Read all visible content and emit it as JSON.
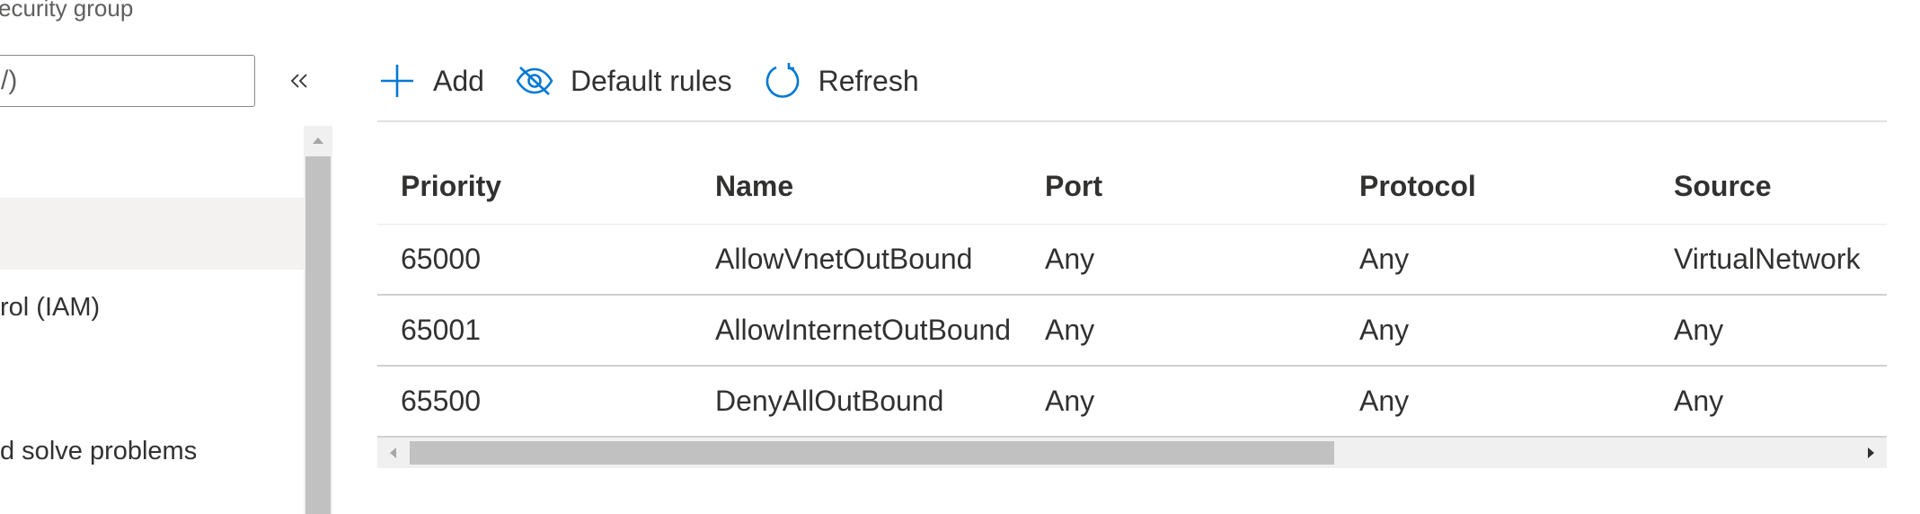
{
  "blade": {
    "subtitle": "ecurity group",
    "search_value": "-/)"
  },
  "menu": {
    "items": [
      {
        "label": ""
      },
      {
        "label": "rol (IAM)"
      },
      {
        "label": ""
      },
      {
        "label": "d solve problems"
      }
    ],
    "selected_index": 0
  },
  "toolbar": {
    "add_label": "Add",
    "default_rules_label": "Default rules",
    "refresh_label": "Refresh"
  },
  "table": {
    "columns": [
      "Priority",
      "Name",
      "Port",
      "Protocol",
      "Source"
    ],
    "rows": [
      [
        "65000",
        "AllowVnetOutBound",
        "Any",
        "Any",
        "VirtualNetwork"
      ],
      [
        "65001",
        "AllowInternetOutBound",
        "Any",
        "Any",
        "Any"
      ],
      [
        "65500",
        "DenyAllOutBound",
        "Any",
        "Any",
        "Any"
      ]
    ]
  },
  "scrollbar": {
    "horizontal_visible_fraction": 0.64
  },
  "colors": {
    "accent": "#0078d4",
    "selected_bg": "#f3f2f1",
    "divider": "#d2d0ce",
    "scroll_thumb": "#c1c1c1"
  },
  "icons": {
    "add": "plus-icon",
    "default_rules": "eye-slash-icon",
    "refresh": "refresh-icon",
    "collapse": "double-chevron-left-icon"
  }
}
